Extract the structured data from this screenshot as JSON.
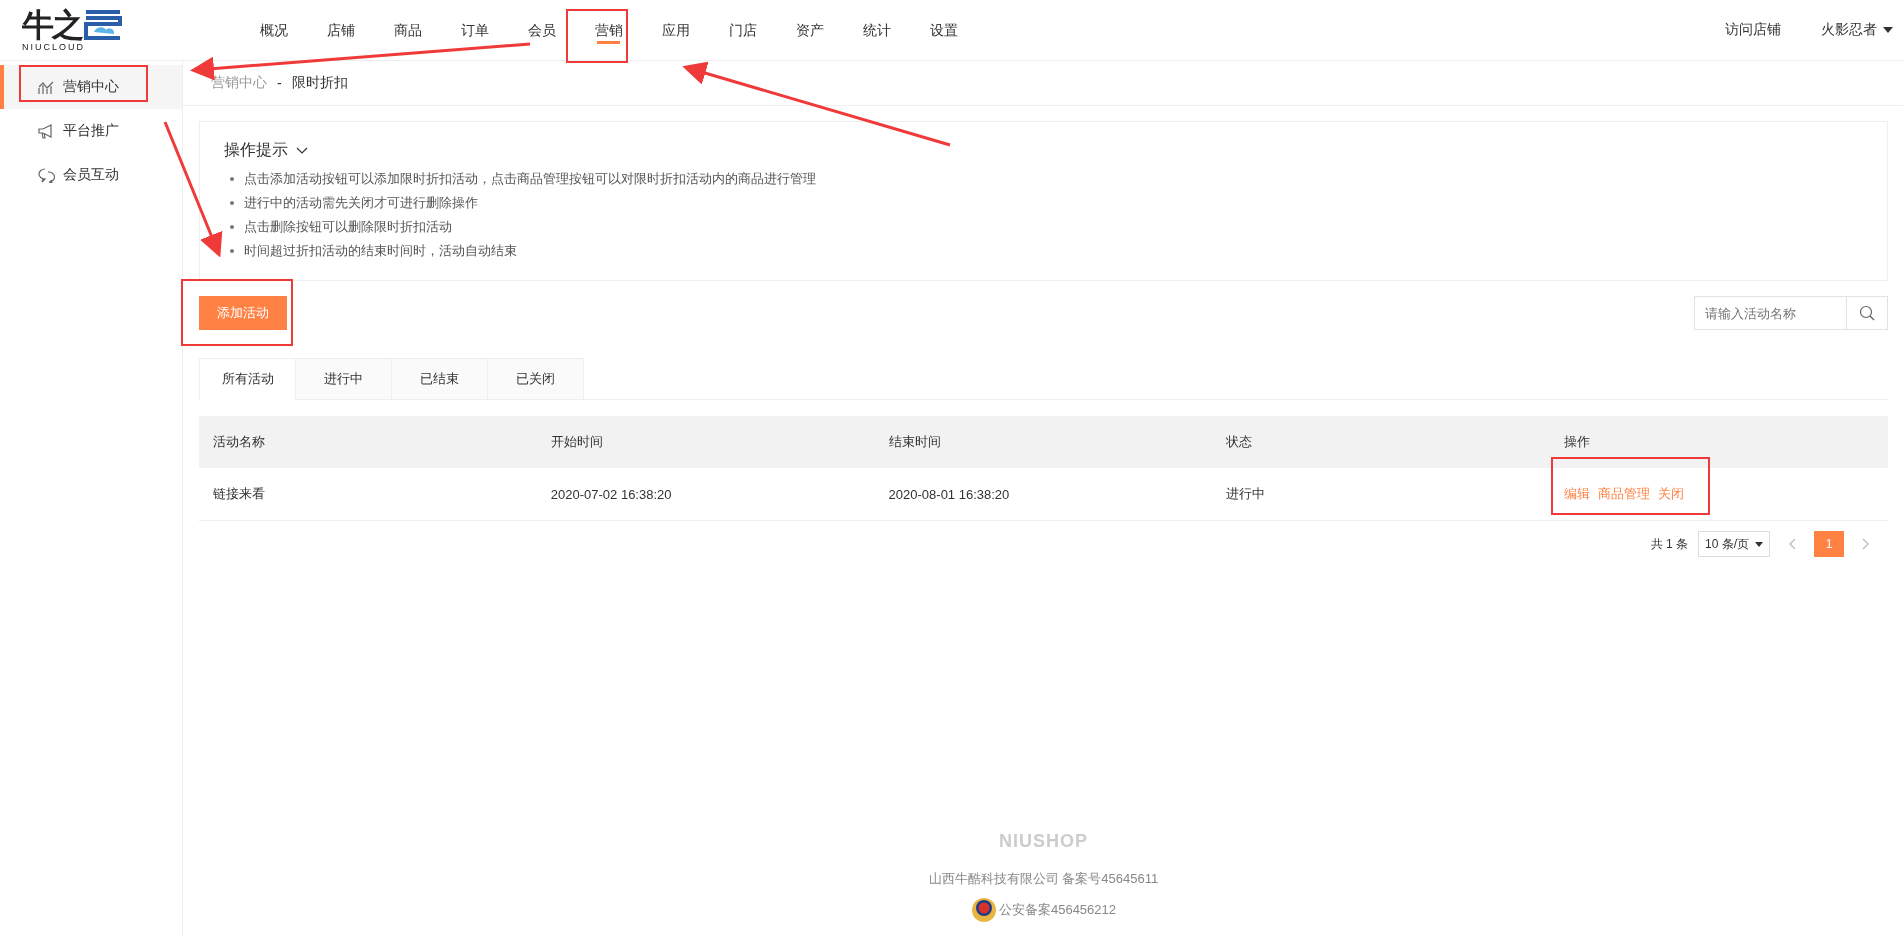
{
  "logo": {
    "mark": "牛之",
    "sub": "NIUCLOUD"
  },
  "nav": [
    {
      "label": "概况",
      "selected": false
    },
    {
      "label": "店铺",
      "selected": false
    },
    {
      "label": "商品",
      "selected": false
    },
    {
      "label": "订单",
      "selected": false
    },
    {
      "label": "会员",
      "selected": false
    },
    {
      "label": "营销",
      "selected": true
    },
    {
      "label": "应用",
      "selected": false
    },
    {
      "label": "门店",
      "selected": false
    },
    {
      "label": "资产",
      "selected": false
    },
    {
      "label": "统计",
      "selected": false
    },
    {
      "label": "设置",
      "selected": false
    }
  ],
  "header_right": {
    "visit": "访问店铺",
    "user": "火影忍者"
  },
  "sidebar": {
    "items": [
      {
        "label": "营销中心",
        "kind": "chart",
        "selected": true
      },
      {
        "label": "平台推广",
        "kind": "megaphone",
        "selected": false
      },
      {
        "label": "会员互动",
        "kind": "chat",
        "selected": false
      }
    ]
  },
  "breadcrumb": [
    "营销中心",
    "-",
    "限时折扣"
  ],
  "tips": {
    "title": "操作提示",
    "expanded": true,
    "items": [
      "点击添加活动按钮可以添加限时折扣活动，点击商品管理按钮可以对限时折扣活动内的商品进行管理",
      "进行中的活动需先关闭才可进行删除操作",
      "点击删除按钮可以删除限时折扣活动",
      "时间超过折扣活动的结束时间时，活动自动结束"
    ]
  },
  "add_button": "添加活动",
  "search": {
    "placeholder": "请输入活动名称"
  },
  "tabs": [
    {
      "label": "所有活动",
      "selected": true
    },
    {
      "label": "进行中",
      "selected": false
    },
    {
      "label": "已结束",
      "selected": false
    },
    {
      "label": "已关闭",
      "selected": false
    }
  ],
  "table": {
    "columns": [
      "活动名称",
      "开始时间",
      "结束时间",
      "状态",
      "操作"
    ],
    "rows": [
      {
        "name": "链接来看",
        "start": "2020-07-02 16:38:20",
        "end": "2020-08-01 16:38:20",
        "status": "进行中",
        "actions": [
          "编辑",
          "商品管理",
          "关闭"
        ]
      }
    ]
  },
  "pagination": {
    "total": "共 1 条",
    "page_size": "10 条/页",
    "pages": [
      {
        "label": "1",
        "selected": true
      }
    ]
  },
  "footer": {
    "brand": "NIUSHOP",
    "company": "山西牛酷科技有限公司  备案号45645611",
    "police": "公安备案456456212"
  }
}
